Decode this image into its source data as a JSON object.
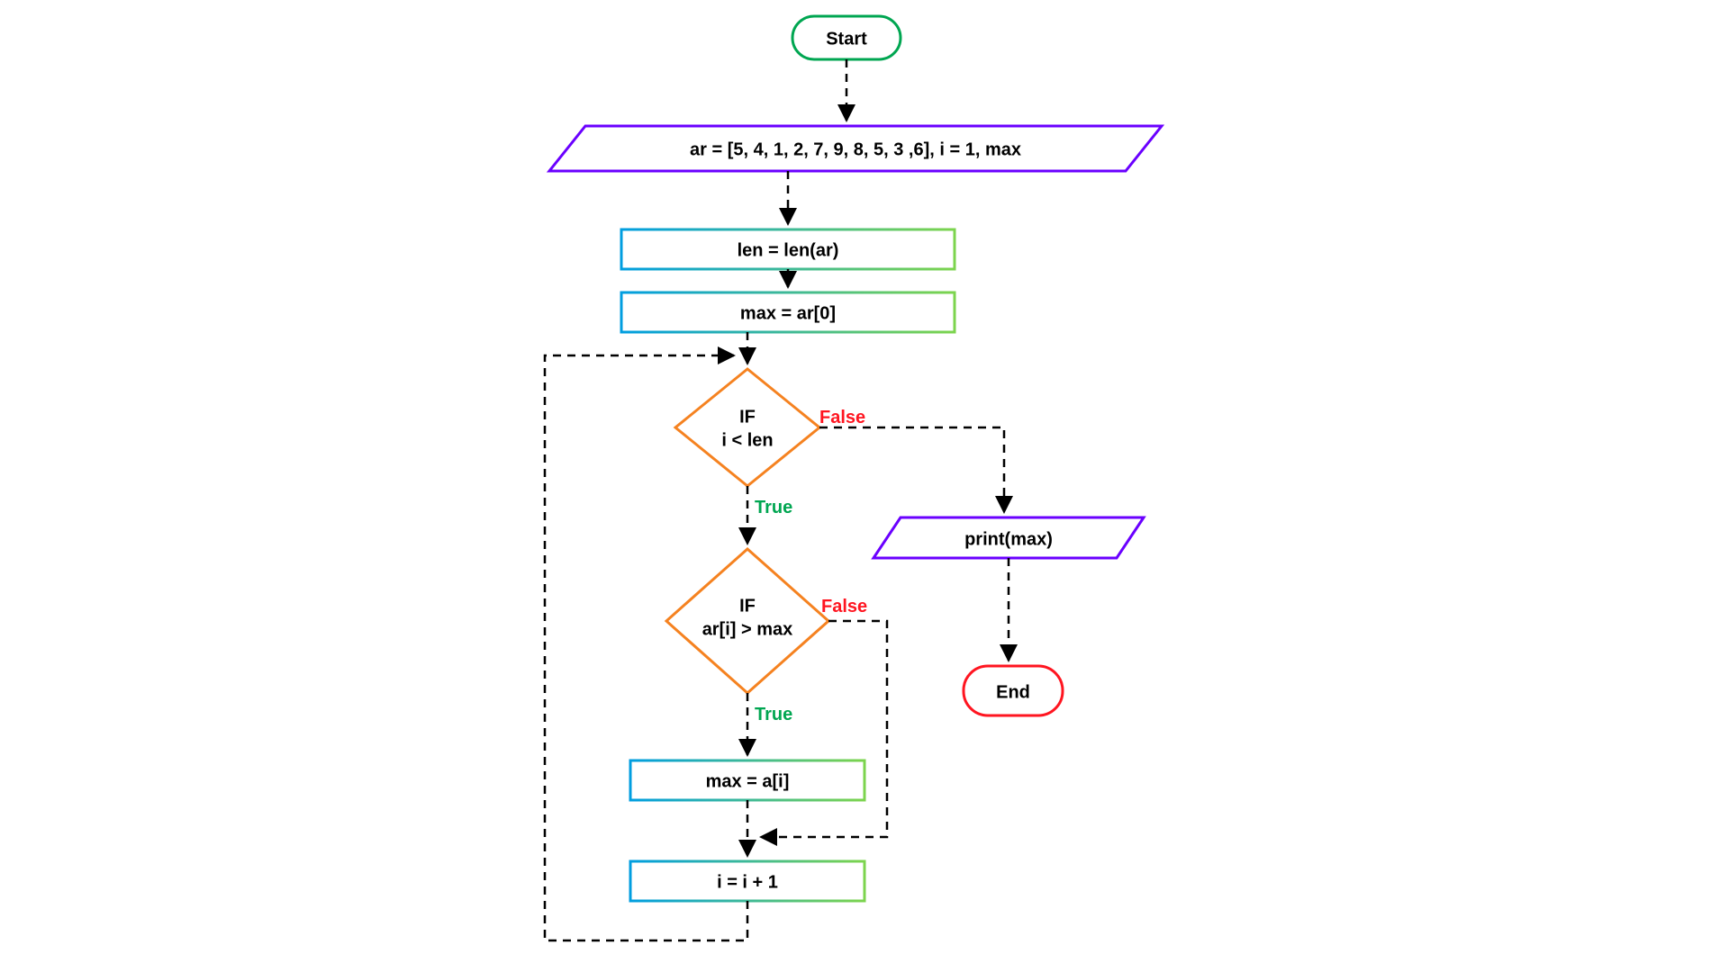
{
  "nodes": {
    "start": {
      "label": "Start"
    },
    "input": {
      "label": "ar = [5, 4, 1, 2, 7, 9, 8, 5, 3 ,6], i = 1,  max"
    },
    "len": {
      "label": "len = len(ar)"
    },
    "max_init": {
      "label": "max = ar[0]"
    },
    "decision1": {
      "line1": "IF",
      "line2": "i < len"
    },
    "decision2": {
      "line1": "IF",
      "line2": "ar[i] > max"
    },
    "assign_max": {
      "label": "max = a[i]"
    },
    "increment": {
      "label": "i = i + 1"
    },
    "output": {
      "label": "print(max)"
    },
    "end": {
      "label": "End"
    }
  },
  "edge_labels": {
    "d1_true": "True",
    "d1_false": "False",
    "d2_true": "True",
    "d2_false": "False"
  },
  "colors": {
    "terminator_start_stroke": "#00a651",
    "terminator_end_stroke": "#ff1520",
    "io_stroke": "#6a00ff",
    "process_grad_from": "#009ee0",
    "process_grad_to": "#7cd44d",
    "decision_stroke": "#f58220",
    "arrow": "#000000"
  }
}
